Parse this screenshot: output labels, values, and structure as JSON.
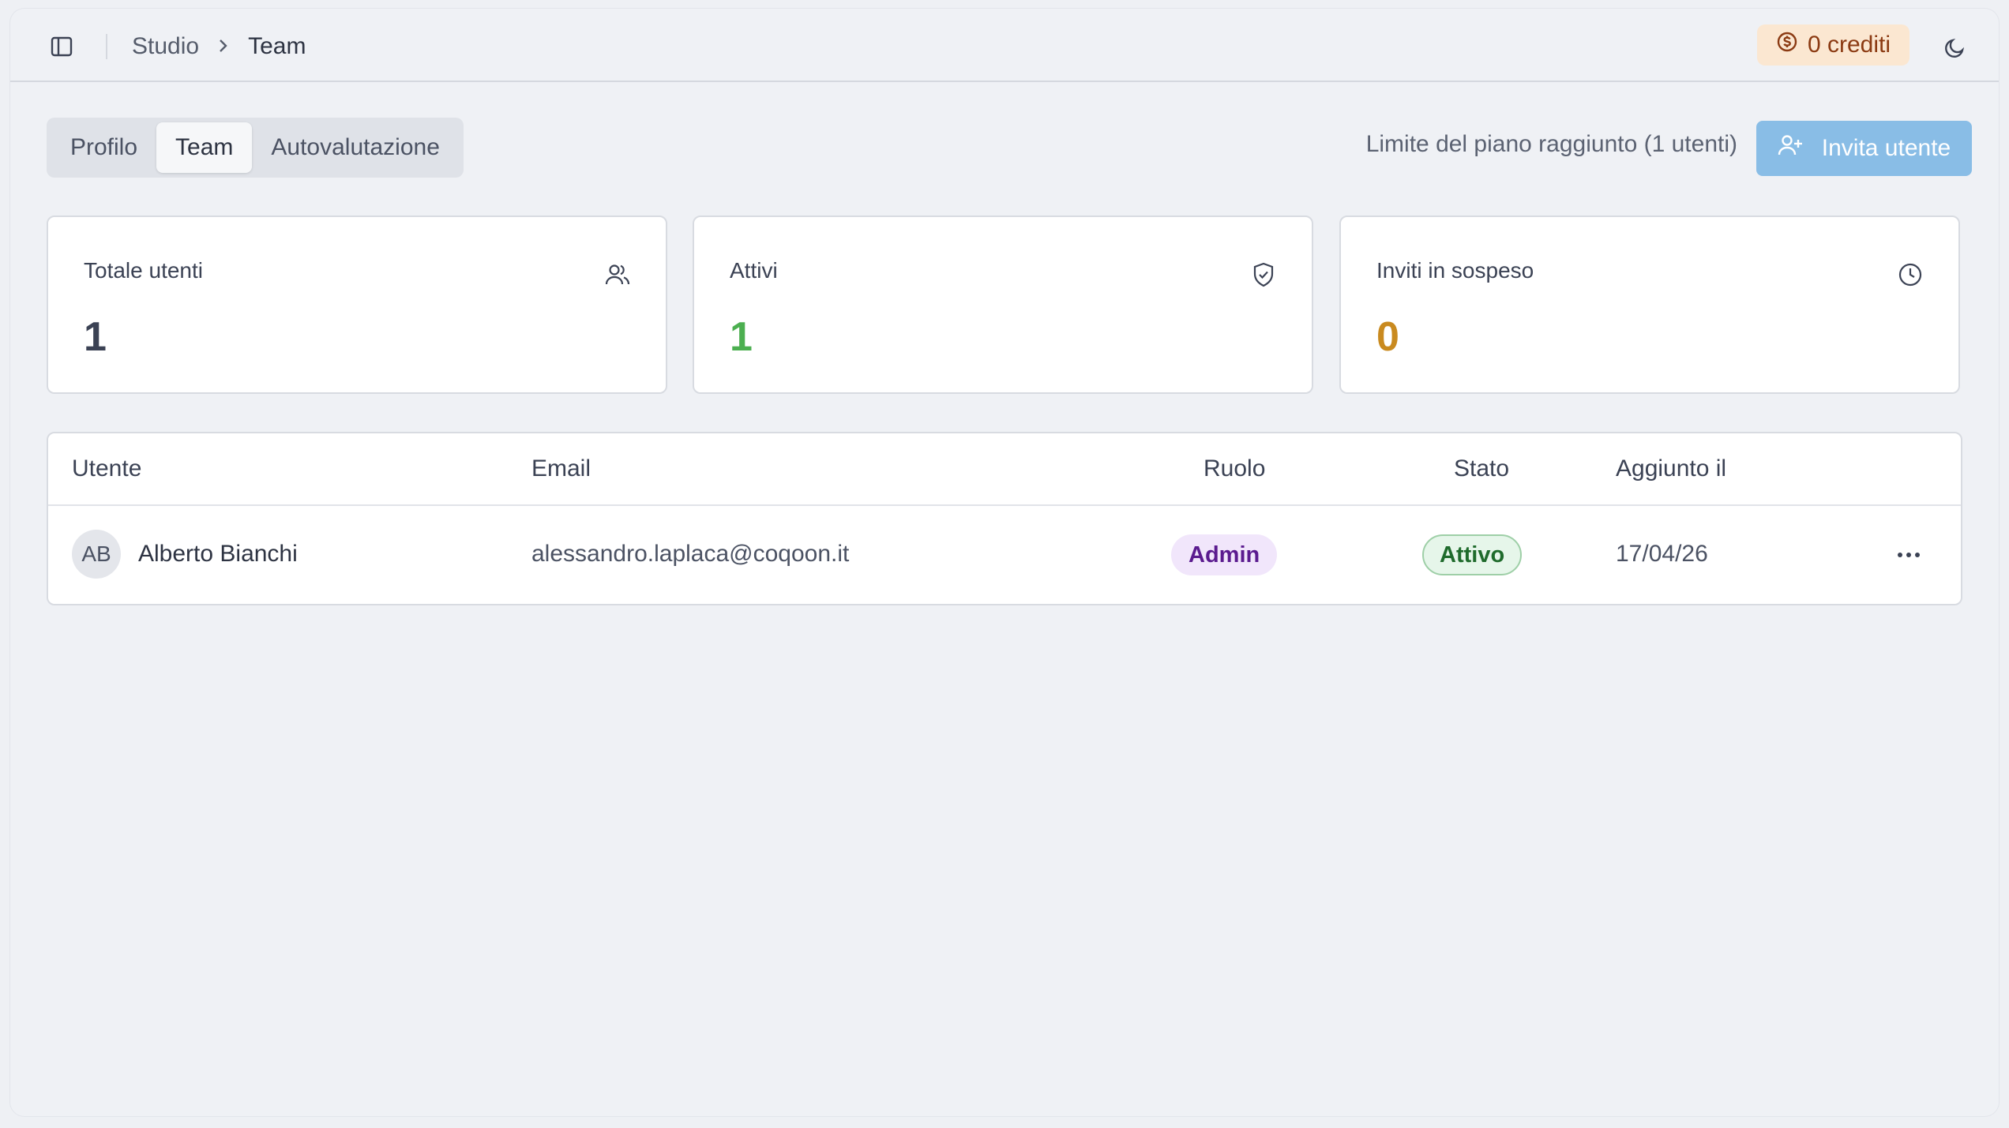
{
  "header": {
    "breadcrumb": {
      "root": "Studio",
      "current": "Team"
    },
    "credits_label": "0 crediti"
  },
  "tabs": [
    {
      "label": "Profilo",
      "active": false
    },
    {
      "label": "Team",
      "active": true
    },
    {
      "label": "Autovalutazione",
      "active": false
    }
  ],
  "plan_limit_text": "Limite del piano raggiunto (1 utenti)",
  "invite_button_label": "Invita utente",
  "stats": [
    {
      "label": "Totale utenti",
      "value": "1",
      "icon": "users-icon",
      "color": "#3b4254"
    },
    {
      "label": "Attivi",
      "value": "1",
      "icon": "shield-check-icon",
      "color": "#4caf50"
    },
    {
      "label": "Inviti in sospeso",
      "value": "0",
      "icon": "clock-icon",
      "color": "#c98a1f"
    }
  ],
  "table": {
    "columns": [
      "Utente",
      "Email",
      "Ruolo",
      "Stato",
      "Aggiunto il"
    ],
    "rows": [
      {
        "initials": "AB",
        "name": "Alberto Bianchi",
        "email": "alessandro.laplaca@coqoon.it",
        "role": "Admin",
        "status": "Attivo",
        "added": "17/04/26"
      }
    ]
  },
  "colors": {
    "accent_button": "#89bde6",
    "credits_bg": "#fbe7d1",
    "role_badge_bg": "#f1e6fb",
    "status_badge_bg": "#e6f6ea"
  }
}
